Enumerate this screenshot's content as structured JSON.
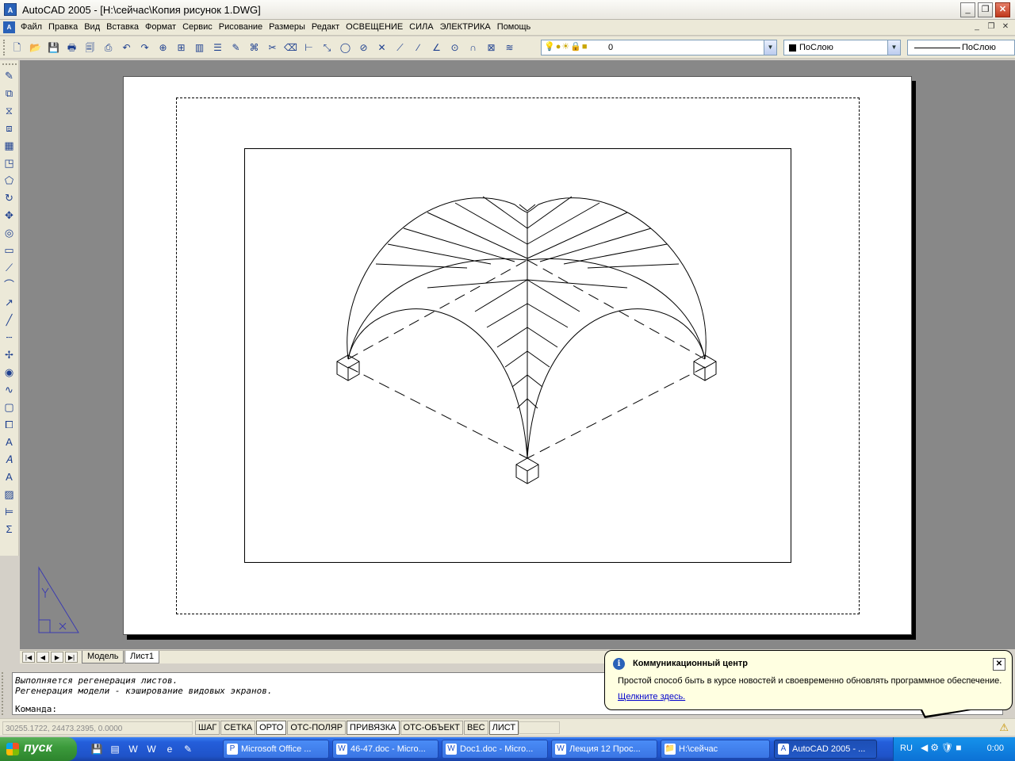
{
  "window": {
    "title": "AutoCAD 2005 - [H:\\сейчас\\Копия рисунок 1.DWG]",
    "app_icon": "autocad-icon",
    "minimize": "_",
    "maximize": "❐",
    "close": "✕"
  },
  "menu": {
    "items": [
      "Файл",
      "Правка",
      "Вид",
      "Вставка",
      "Формат",
      "Сервис",
      "Рисование",
      "Размеры",
      "Редакт",
      "ОСВЕЩЕНИЕ",
      "СИЛА",
      "ЭЛЕКТРИКА",
      "Помощь"
    ],
    "mdi_minimize": "_",
    "mdi_restore": "❐",
    "mdi_close": "✕"
  },
  "toolbar": {
    "icons": [
      "new-icon",
      "open-icon",
      "save-icon",
      "print-icon",
      "preview-icon",
      "publish-icon",
      "undo-icon",
      "redo-icon",
      "zoom-icon",
      "zoom-window-icon",
      "tile-icon",
      "properties-icon",
      "pencil-icon",
      "match-icon",
      "cut-icon",
      "erase-icon",
      "measure-icon",
      "break-icon",
      "circle-icon",
      "ban-icon",
      "cross-icon",
      "line-icon",
      "slash-icon",
      "angle-icon",
      "snap-icon",
      "magnet-icon",
      "hatch-icon",
      "layers-icon"
    ],
    "layer": {
      "state_icons": "💡●☀🔒■",
      "name": "0"
    },
    "color": {
      "label": "ПоСлою",
      "swatch": "#000000"
    },
    "linetype": {
      "label": "ПоСлою"
    }
  },
  "left_toolbar": {
    "icons": [
      "line-draw-icon",
      "copy-icon",
      "mirror-icon",
      "offset-icon",
      "array-icon",
      "scale-icon",
      "polygon-icon",
      "rotate-icon",
      "move-icon",
      "circle-draw-icon",
      "rectangle-icon",
      "polyline-icon",
      "arc-icon",
      "ray-icon",
      "construction-line-icon",
      "dashed-line-icon",
      "xline-icon",
      "donut-icon",
      "spline-icon",
      "region-icon",
      "block-icon",
      "mtext-icon",
      "text-style-icon",
      "text-icon",
      "hatch-draw-icon",
      "dimension-icon",
      "sum-icon"
    ]
  },
  "tabs": {
    "nav": [
      "|◀",
      "◀",
      "▶",
      "▶|"
    ],
    "model": "Модель",
    "layout": "Лист1"
  },
  "command": {
    "line1": "Выполняется регенерация листов.",
    "line2": "Регенерация модели - кэширование видовых экранов.",
    "prompt": "Команда:"
  },
  "status": {
    "coords": "30255.1722, 24473.2395, 0.0000",
    "toggles": [
      {
        "label": "ШАГ",
        "on": false
      },
      {
        "label": "СЕТКА",
        "on": false
      },
      {
        "label": "ОРТО",
        "on": true
      },
      {
        "label": "ОТС-ПОЛЯР",
        "on": false
      },
      {
        "label": "ПРИВЯЗКА",
        "on": true
      },
      {
        "label": "ОТС-ОБЪЕКТ",
        "on": false
      },
      {
        "label": "ВЕС",
        "on": false
      },
      {
        "label": "ЛИСТ",
        "on": true
      }
    ],
    "tray_icon": "warning-icon"
  },
  "balloon": {
    "title": "Коммуникационный центр",
    "body": "Простой способ быть в курсе новостей и своевременно обновлять программное обеспечение.",
    "link": "Щелкните здесь.",
    "close": "✕"
  },
  "taskbar": {
    "start": "пуск",
    "quick_launch": [
      "save-icon",
      "notepad-icon",
      "word-icon",
      "word-icon",
      "ie-icon",
      "edit-icon"
    ],
    "tasks": [
      {
        "label": "Microsoft Office ...",
        "icon": "powerpoint-icon",
        "active": false
      },
      {
        "label": "46-47.doc - Micro...",
        "icon": "word-icon",
        "active": false
      },
      {
        "label": "Doc1.doc - Micro...",
        "icon": "word-icon",
        "active": false
      },
      {
        "label": "Лекция   12 Прос...",
        "icon": "word-icon",
        "active": false
      },
      {
        "label": "H:\\сейчас",
        "icon": "folder-icon",
        "active": false
      },
      {
        "label": "AutoCAD 2005 - ...",
        "icon": "autocad-icon",
        "active": true
      }
    ],
    "lang": "RU",
    "clock": "0:00"
  }
}
